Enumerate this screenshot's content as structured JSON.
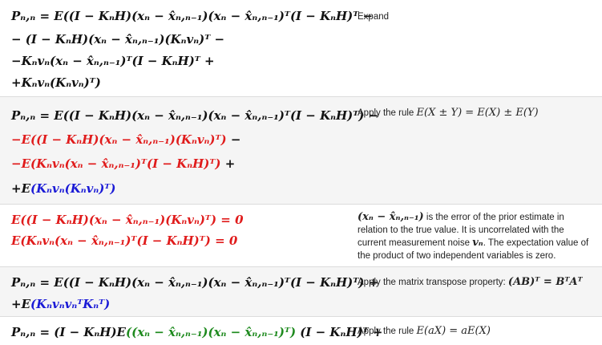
{
  "rows": [
    {
      "lines": [
        {
          "text": "Pₙ,ₙ = E((I − KₙH)(xₙ − x̂ₙ,ₙ₋₁)(xₙ − x̂ₙ,ₙ₋₁)ᵀ(I − KₙH)ᵀ −"
        },
        {
          "text": "− (I − KₙH)(xₙ − x̂ₙ,ₙ₋₁)(Kₙvₙ)ᵀ −"
        },
        {
          "text": "−Kₙvₙ(xₙ − x̂ₙ,ₙ₋₁)ᵀ(I − KₙH)ᵀ +"
        },
        {
          "text": "+Kₙvₙ(Kₙvₙ)ᵀ)"
        }
      ],
      "note": "Expand"
    },
    {
      "lines": [
        {
          "text": "Pₙ,ₙ = E((I − KₙH)(xₙ − x̂ₙ,ₙ₋₁)(xₙ − x̂ₙ,ₙ₋₁)ᵀ(I − KₙH)ᵀ) −"
        },
        {
          "prefix": "−E",
          "colored": "((I − KₙH)(xₙ − x̂ₙ,ₙ₋₁)(Kₙvₙ)ᵀ)",
          "suffix": " −"
        },
        {
          "prefix": "−E",
          "colored": "(Kₙvₙ(xₙ − x̂ₙ,ₙ₋₁)ᵀ(I − KₙH)ᵀ)",
          "suffix": " +"
        },
        {
          "prefix": "+E",
          "colored": "(Kₙvₙ(Kₙvₙ)ᵀ)",
          "suffix": ""
        }
      ],
      "note_text": "Apply the rule ",
      "note_math": "E(X ± Y) = E(X) ± E(Y)"
    },
    {
      "lines": [
        {
          "text": "E((I − KₙH)(xₙ − x̂ₙ,ₙ₋₁)(Kₙvₙ)ᵀ) = 0"
        },
        {
          "text": "E(Kₙvₙ(xₙ − x̂ₙ,ₙ₋₁)ᵀ(I − KₙH)ᵀ) = 0"
        }
      ],
      "note_math": "(xₙ − x̂ₙ,ₙ₋₁)",
      "note_text1": " is the error of the prior estimate in relation to the true value. It is uncorrelated with the current measurement noise ",
      "note_math2": "vₙ",
      "note_text2": ". The expectation value of the product of two independent variables is zero."
    },
    {
      "lines": [
        {
          "text": "Pₙ,ₙ = E((I − KₙH)(xₙ − x̂ₙ,ₙ₋₁)(xₙ − x̂ₙ,ₙ₋₁)ᵀ(I − KₙH)ᵀ) +"
        },
        {
          "prefix": "+E",
          "colored": "(KₙvₙvₙᵀKₙᵀ)",
          "suffix": ""
        }
      ],
      "note_text": "Apply the matrix transpose property: ",
      "note_math": "(AB)ᵀ = BᵀAᵀ"
    },
    {
      "lines": [
        {
          "prefix": "Pₙ,ₙ = (I − KₙH)E",
          "colored": "((xₙ − x̂ₙ,ₙ₋₁)(xₙ − x̂ₙ,ₙ₋₁)ᵀ)",
          "suffix": " (I − KₙH)ᵀ +"
        }
      ],
      "note_text": "Apply the rule ",
      "note_math": "E(aX) = aE(X)"
    }
  ],
  "colors": {
    "red": "#e01b1b",
    "blue": "#1a1ad6",
    "green": "#1e8a1e",
    "row_alt": "#f5f5f5",
    "divider": "#dcdcdc"
  }
}
